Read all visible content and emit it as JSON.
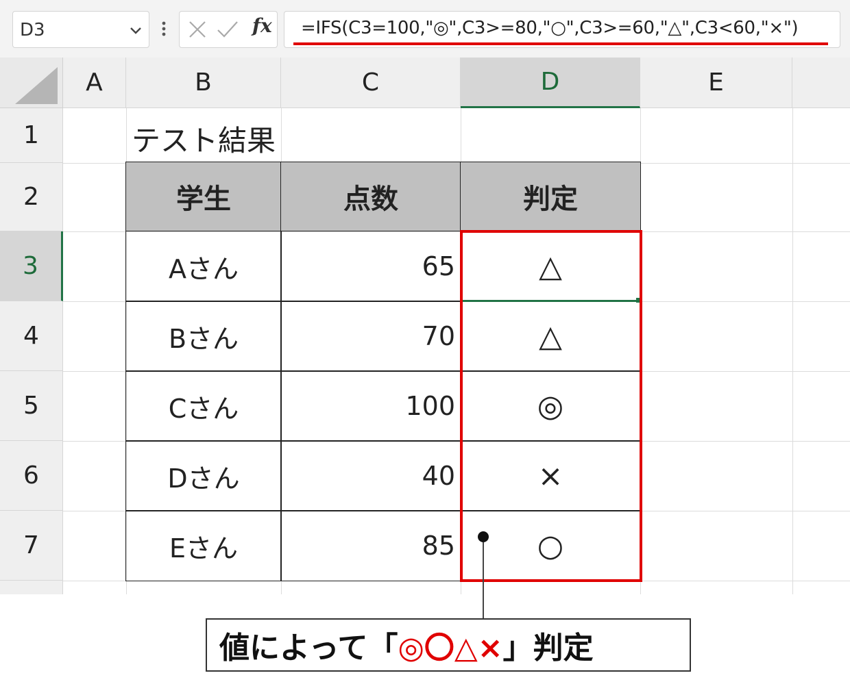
{
  "formula_bar": {
    "name_box": "D3",
    "fx_label": "fx",
    "formula": "=IFS(C3=100,\"◎\",C3>=80,\"○\",C3>=60,\"△\",C3<60,\"×\")"
  },
  "columns": [
    "A",
    "B",
    "C",
    "D",
    "E"
  ],
  "rows": [
    "1",
    "2",
    "3",
    "4",
    "5",
    "6",
    "7"
  ],
  "selected_cell": "D3",
  "sheet": {
    "b1": "テスト結果",
    "headers": {
      "student": "学生",
      "score": "点数",
      "judgement": "判定"
    },
    "records": [
      {
        "student": "Aさん",
        "score": "65",
        "mark": "△"
      },
      {
        "student": "Bさん",
        "score": "70",
        "mark": "△"
      },
      {
        "student": "Cさん",
        "score": "100",
        "mark": "◎"
      },
      {
        "student": "Dさん",
        "score": "40",
        "mark": "×"
      },
      {
        "student": "Eさん",
        "score": "85",
        "mark": "○"
      }
    ]
  },
  "callout": {
    "prefix": "値によって「",
    "symbols": "◎〇△×",
    "suffix": "」判定"
  },
  "colors": {
    "accent": "#217346",
    "highlight": "#e00000",
    "header_fill": "#c0c0c0"
  }
}
